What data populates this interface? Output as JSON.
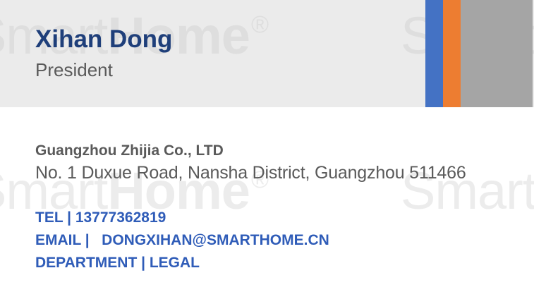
{
  "colors": {
    "name": "#1f3f7a",
    "accent_blue": "#4472c4",
    "accent_orange": "#ed7d31",
    "accent_gray": "#a5a5a5",
    "header_bg": "#ebebeb",
    "body_text": "#5a5a5a",
    "contact_text": "#2f5cb8"
  },
  "watermark": {
    "light": "Smart",
    "bold": "Home",
    "mark": "®"
  },
  "person": {
    "name": "Xihan Dong",
    "title": "President"
  },
  "company": {
    "name": "Guangzhou Zhijia Co., LTD",
    "address": "No. 1 Duxue Road, Nansha District, Guangzhou 511466"
  },
  "contacts": {
    "tel": "TEL | 13777362819",
    "email": "EMAIL |   DONGXIHAN@SMARTHOME.CN",
    "department": "DEPARTMENT | LEGAL"
  }
}
